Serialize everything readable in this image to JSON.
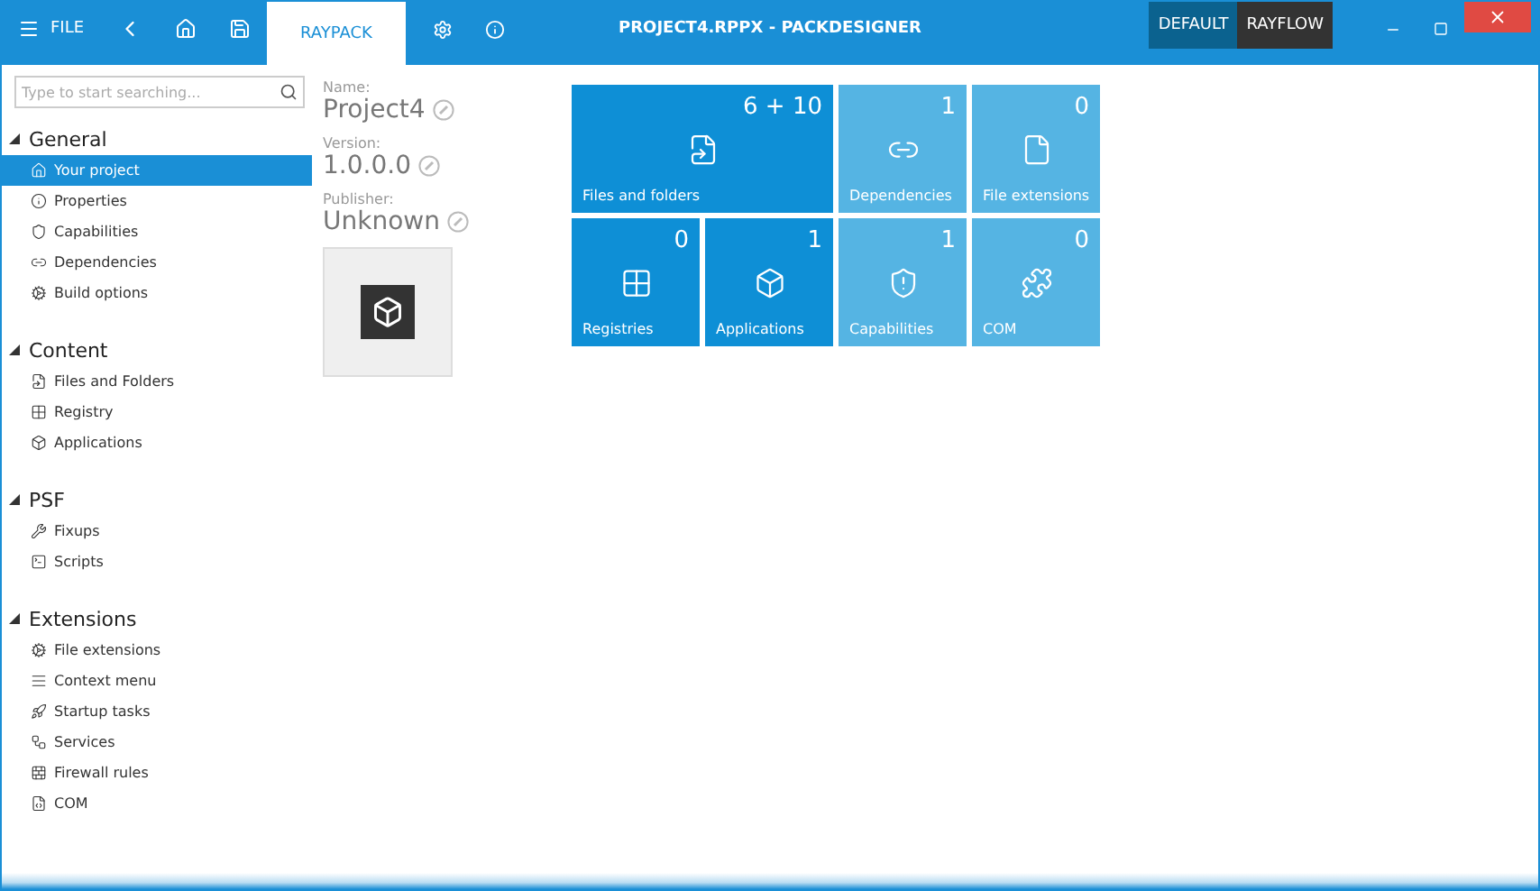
{
  "window": {
    "title": "PROJECT4.RPPX - PACKDESIGNER"
  },
  "menu": {
    "label": "FILE"
  },
  "tabs": [
    {
      "label": "RAYPACK",
      "selected": true
    }
  ],
  "modes": [
    {
      "label": "DEFAULT",
      "selected": false
    },
    {
      "label": "RAYFLOW",
      "selected": true
    }
  ],
  "search": {
    "placeholder": "Type to start searching..."
  },
  "sidebar": {
    "sections": [
      {
        "title": "General",
        "expanded": true,
        "items": [
          {
            "label": "Your project",
            "selected": true
          },
          {
            "label": "Properties",
            "selected": false
          },
          {
            "label": "Capabilities",
            "selected": false
          },
          {
            "label": "Dependencies",
            "selected": false
          },
          {
            "label": "Build options",
            "selected": false
          }
        ]
      },
      {
        "title": "Content",
        "expanded": true,
        "items": [
          {
            "label": "Files and Folders",
            "selected": false
          },
          {
            "label": "Registry",
            "selected": false
          },
          {
            "label": "Applications",
            "selected": false
          }
        ]
      },
      {
        "title": "PSF",
        "expanded": true,
        "items": [
          {
            "label": "Fixups",
            "selected": false
          },
          {
            "label": "Scripts",
            "selected": false
          }
        ]
      },
      {
        "title": "Extensions",
        "expanded": true,
        "items": [
          {
            "label": "File extensions",
            "selected": false
          },
          {
            "label": "Context menu",
            "selected": false
          },
          {
            "label": "Startup tasks",
            "selected": false
          },
          {
            "label": "Services",
            "selected": false
          },
          {
            "label": "Firewall rules",
            "selected": false
          },
          {
            "label": "COM",
            "selected": false
          }
        ]
      }
    ]
  },
  "project": {
    "fields": [
      {
        "label": "Name:",
        "value": "Project4"
      },
      {
        "label": "Version:",
        "value": "1.0.0.0"
      },
      {
        "label": "Publisher:",
        "value": "Unknown"
      }
    ]
  },
  "tiles": [
    {
      "label": "Files and folders",
      "count": "6 + 10",
      "highlighted": true,
      "kind": "wide"
    },
    {
      "label": "Dependencies",
      "count": "1",
      "highlighted": false,
      "kind": "small"
    },
    {
      "label": "File extensions",
      "count": "0",
      "highlighted": false,
      "kind": "small"
    },
    {
      "label": "Registries",
      "count": "0",
      "highlighted": true,
      "kind": "small"
    },
    {
      "label": "Applications",
      "count": "1",
      "highlighted": true,
      "kind": "small"
    },
    {
      "label": "Capabilities",
      "count": "1",
      "highlighted": false,
      "kind": "small"
    },
    {
      "label": "COM",
      "count": "0",
      "highlighted": false,
      "kind": "small"
    }
  ]
}
